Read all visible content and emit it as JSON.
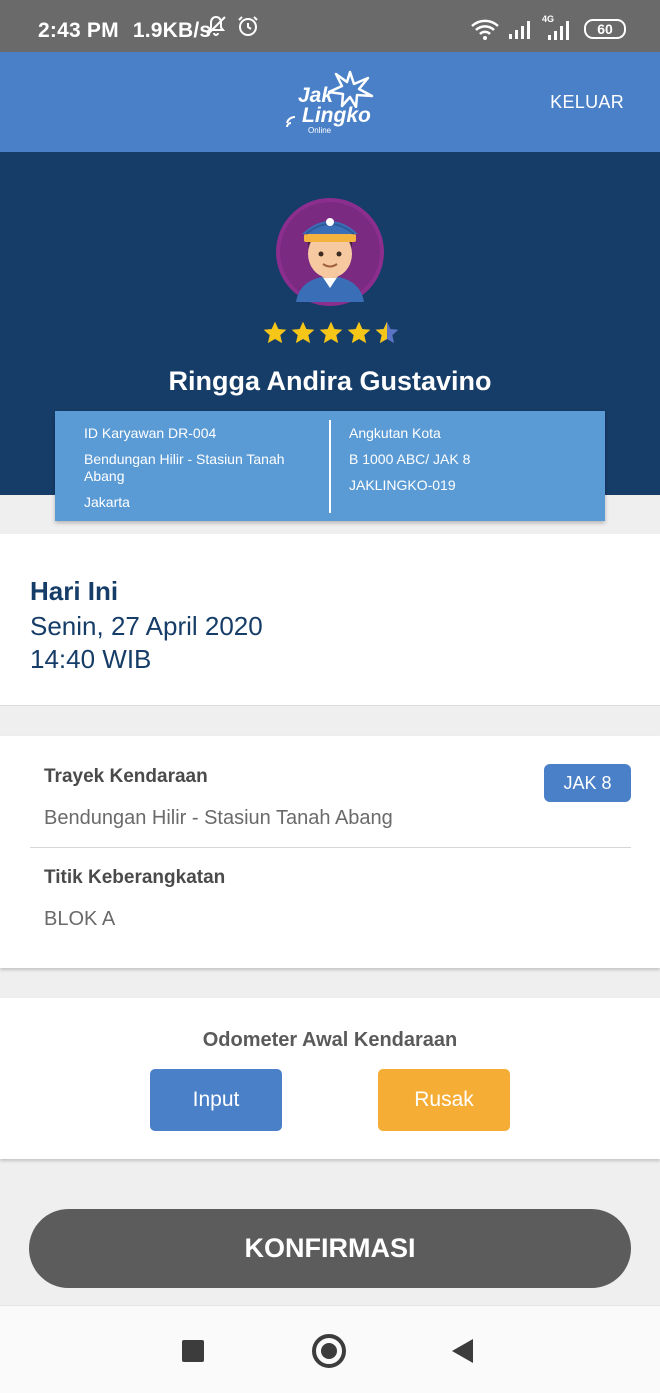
{
  "status_bar": {
    "time": "2:43 PM",
    "speed": "1.9KB/s",
    "network": "4G",
    "battery": "60",
    "icons": [
      "mute-bell-icon",
      "alarm-icon",
      "wifi-icon",
      "signal-icon",
      "signal-4g-icon",
      "battery-icon"
    ]
  },
  "app_bar": {
    "logo_line1": "Jak",
    "logo_line2": "Lingko",
    "logo_sub": "Online",
    "logout_label": "KELUAR",
    "background": "#4a80c8"
  },
  "profile": {
    "name": "Ringga Andira Gustavino",
    "rating": 4.5,
    "rating_max": 5,
    "avatar_icon": "driver-avatar-icon",
    "background": "#163d68"
  },
  "info_card": {
    "employee_id": "ID Karyawan DR-004",
    "route": "Bendungan Hilir - Stasiun Tanah Abang",
    "city": "Jakarta",
    "vehicle_type": "Angkutan Kota",
    "plate": "B 1000 ABC/ JAK 8",
    "fleet_code": "JAKLINGKO-019"
  },
  "today": {
    "title": "Hari Ini",
    "date": "Senin, 27 April 2020",
    "time": "14:40 WIB"
  },
  "route_card": {
    "route_label": "Trayek Kendaraan",
    "route_value": "Bendungan Hilir - Stasiun Tanah Abang",
    "route_code": "JAK 8",
    "departure_label": "Titik Keberangkatan",
    "departure_value": "BLOK A"
  },
  "odometer": {
    "title": "Odometer Awal Kendaraan",
    "input_label": "Input",
    "broken_label": "Rusak",
    "input_color": "#4a80c8",
    "broken_color": "#f5ad36"
  },
  "confirm": {
    "label": "KONFIRMASI"
  },
  "nav_bar": {
    "icons": [
      "recent-apps-icon",
      "home-icon",
      "back-icon"
    ]
  }
}
